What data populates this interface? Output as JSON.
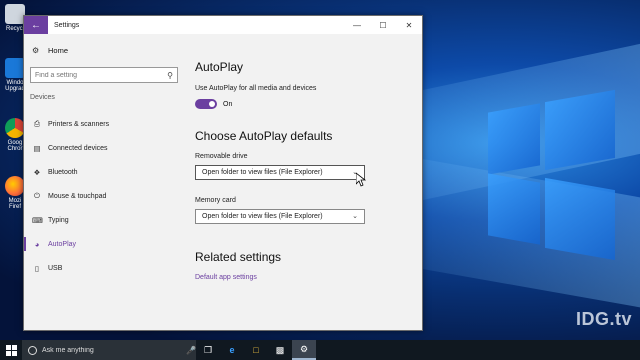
{
  "window": {
    "title": "Settings",
    "controls": [
      "—",
      "☐",
      "✕"
    ]
  },
  "sidebar": {
    "home_label": "Home",
    "search_placeholder": "Find a setting",
    "section_label": "Devices",
    "items": [
      {
        "label": "Printers & scanners",
        "icon": "printer-icon"
      },
      {
        "label": "Connected devices",
        "icon": "devices-icon"
      },
      {
        "label": "Bluetooth",
        "icon": "bluetooth-icon"
      },
      {
        "label": "Mouse & touchpad",
        "icon": "mouse-icon"
      },
      {
        "label": "Typing",
        "icon": "keyboard-icon"
      },
      {
        "label": "AutoPlay",
        "icon": "autoplay-icon",
        "active": true
      },
      {
        "label": "USB",
        "icon": "usb-icon"
      }
    ]
  },
  "main": {
    "autoplay_heading": "AutoPlay",
    "toggle_label": "Use AutoPlay for all media and devices",
    "toggle_state": "On",
    "defaults_heading": "Choose AutoPlay defaults",
    "removable_label": "Removable drive",
    "removable_value": "Open folder to view files (File Explorer)",
    "memory_label": "Memory card",
    "memory_value": "Open folder to view files (File Explorer)",
    "related_heading": "Related settings",
    "related_link": "Default app settings"
  },
  "taskbar": {
    "search_placeholder": "Ask me anything"
  },
  "desktop": {
    "icons": [
      {
        "label": "Recycl",
        "icon": "recycle-bin-icon"
      },
      {
        "label": "Windo Upgrad",
        "icon": "windows-upgrade-icon"
      },
      {
        "label": "Goog Chror",
        "icon": "chrome-icon"
      },
      {
        "label": "Mozi Firef",
        "icon": "firefox-icon"
      }
    ],
    "watermark": "IDG.tv"
  },
  "colors": {
    "accent": "#6b3fa0",
    "taskbar": "#101820"
  }
}
